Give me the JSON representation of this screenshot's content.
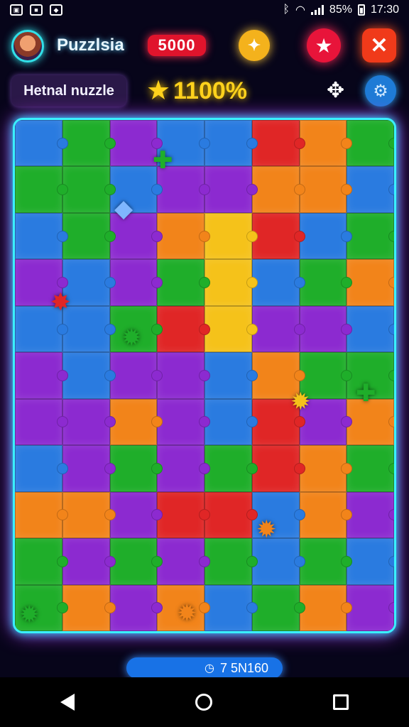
{
  "status_bar": {
    "battery": "85%",
    "time": "17:30"
  },
  "header": {
    "app_name": "Puzzlsia",
    "coins": "5000",
    "hint_icon": "sparkle-icon",
    "favorite_icon": "star-icon",
    "close_icon": "close-icon"
  },
  "puzzle": {
    "title": "Hetnal nuzzle",
    "progress": "1100%",
    "tools_icon": "scatter-icon",
    "settings_icon": "gear-icon"
  },
  "board": {
    "columns": 8,
    "rows": 11,
    "colors": {
      "G": "#1fae2a",
      "B": "#2a7be0",
      "O": "#f2841a",
      "P": "#8c2ad0",
      "R": "#e02626",
      "Y": "#f5c21a",
      "C": "#31c2ff"
    },
    "grid": [
      "BGPBBROG",
      "GGBPPOOB",
      "BGPOYRBG",
      "PBPGYBGO",
      "BBGRYPPB",
      "PBPPBOGG",
      "PPOPBRPO",
      "BPGPGROG",
      "OOPRRBOP",
      "GPGPGBGB",
      "GOPOBGOP"
    ]
  },
  "footer": {
    "counter": "7 5N160"
  }
}
